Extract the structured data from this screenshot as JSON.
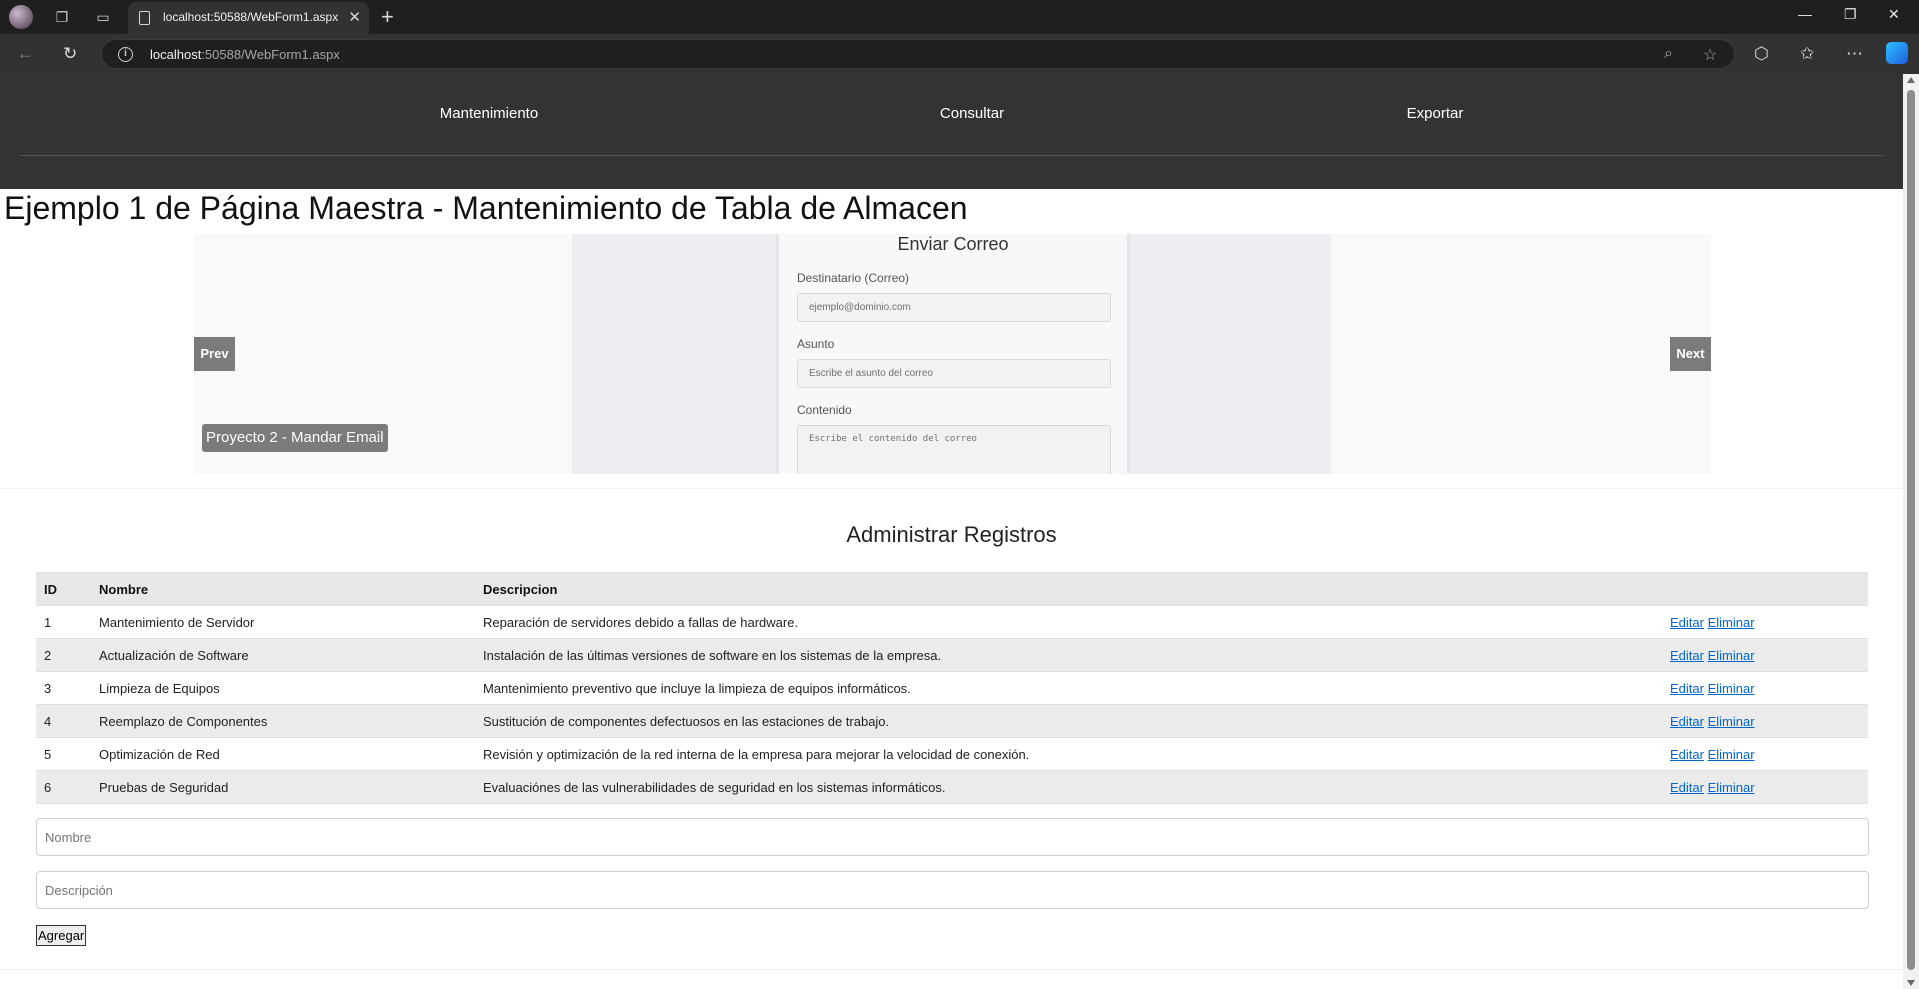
{
  "browser": {
    "tab_title": "localhost:50588/WebForm1.aspx",
    "url_host": "localhost",
    "url_rest": ":50588/WebForm1.aspx",
    "icons": {
      "workspaces": "workspaces-icon",
      "tab_actions": "tab-actions-icon",
      "back": "back-arrow-icon",
      "refresh": "refresh-icon",
      "zoom": "zoom-icon",
      "favorite": "star-icon",
      "extensions": "extensions-icon",
      "favorites": "favorites-icon",
      "menu": "more-icon",
      "copilot": "copilot-icon"
    }
  },
  "nav": {
    "items": [
      {
        "label": "Mantenimiento"
      },
      {
        "label": "Consultar"
      },
      {
        "label": "Exportar"
      }
    ]
  },
  "page": {
    "title": "Ejemplo 1 de Página Maestra - Mantenimiento de Tabla de Almacen"
  },
  "carousel": {
    "prev_label": "Prev",
    "next_label": "Next",
    "caption": "Proyecto 2 - Mandar Email",
    "slide": {
      "heading": "Enviar Correo",
      "to_label": "Destinatario (Correo)",
      "to_placeholder": "ejemplo@dominio.com",
      "subject_label": "Asunto",
      "subject_placeholder": "Escribe el asunto del correo",
      "content_label": "Contenido",
      "content_placeholder": "Escribe el contenido del correo"
    }
  },
  "records": {
    "heading": "Administrar Registros",
    "columns": [
      "ID",
      "Nombre",
      "Descripcion",
      ""
    ],
    "edit_label": "Editar",
    "delete_label": "Eliminar",
    "rows": [
      {
        "id": "1",
        "nombre": "Mantenimiento de Servidor",
        "descripcion": "Reparación de servidores debido a fallas de hardware."
      },
      {
        "id": "2",
        "nombre": "Actualización de Software",
        "descripcion": "Instalación de las últimas versiones de software en los sistemas de la empresa."
      },
      {
        "id": "3",
        "nombre": "Limpieza de Equipos",
        "descripcion": "Mantenimiento preventivo que incluye la limpieza de equipos informáticos."
      },
      {
        "id": "4",
        "nombre": "Reemplazo de Componentes",
        "descripcion": "Sustitución de componentes defectuosos en las estaciones de trabajo."
      },
      {
        "id": "5",
        "nombre": "Optimización de Red",
        "descripcion": "Revisión y optimización de la red interna de la empresa para mejorar la velocidad de conexión."
      },
      {
        "id": "6",
        "nombre": "Pruebas de Seguridad",
        "descripcion": "Evaluaciónes de las vulnerabilidades de seguridad en los sistemas informáticos."
      }
    ]
  },
  "form": {
    "nombre_placeholder": "Nombre",
    "descripcion_placeholder": "Descripción",
    "add_label": "Agregar"
  },
  "colors": {
    "header_bg": "#333333",
    "link": "#0066cc",
    "carousel_button": "#7b7b7b"
  }
}
